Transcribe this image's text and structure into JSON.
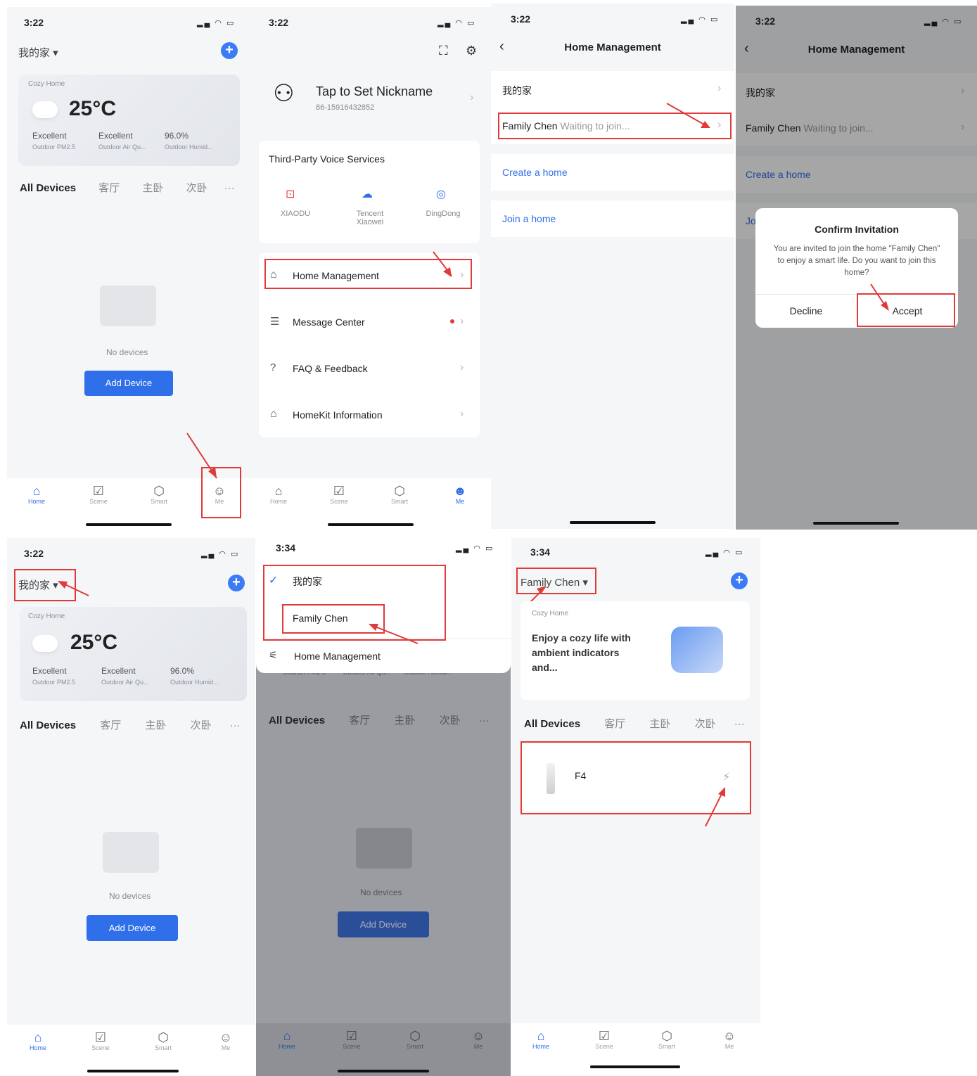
{
  "p1": {
    "time": "3:22",
    "home_selector": "我的家 ▾",
    "weather": {
      "title": "Cozy Home",
      "temp": "25°C",
      "m1_value": "Excellent",
      "m1_label": "Outdoor PM2.5",
      "m2_value": "Excellent",
      "m2_label": "Outdoor Air Qu...",
      "m3_value": "96.0%",
      "m3_label": "Outdoor Humid..."
    },
    "tabs": [
      "All Devices",
      "客厅",
      "主卧",
      "次卧",
      "···"
    ],
    "no_devices": "No devices",
    "add_device": "Add Device",
    "nav": [
      "Home",
      "Scene",
      "Smart",
      "Me"
    ]
  },
  "p2": {
    "time": "3:22",
    "nickname": "Tap to Set Nickname",
    "phone": "86-15916432852",
    "voice_title": "Third-Party Voice Services",
    "voice": [
      "XIAODU",
      "Tencent Xiaowei",
      "DingDong"
    ],
    "menu": [
      "Home Management",
      "Message Center",
      "FAQ & Feedback",
      "HomeKit Information"
    ],
    "nav": [
      "Home",
      "Scene",
      "Smart",
      "Me"
    ]
  },
  "p3": {
    "time": "3:22",
    "title": "Home Management",
    "home1": "我的家",
    "home2_name": "Family Chen",
    "home2_status": "Waiting to join...",
    "create": "Create a home",
    "join": "Join a home"
  },
  "p4": {
    "time": "3:22",
    "title": "Home Management",
    "home1": "我的家",
    "home2_name": "Family Chen",
    "home2_status": "Waiting to join...",
    "create": "Create a home",
    "join_partial": "Jo",
    "dialog_title": "Confirm Invitation",
    "dialog_body": "You are invited to join the home \"Family Chen\" to enjoy a smart life. Do you want to join this home?",
    "decline": "Decline",
    "accept": "Accept"
  },
  "p5": {
    "time": "3:22",
    "home_selector": "我的家 ▾",
    "weather": {
      "title": "Cozy Home",
      "temp": "25°C",
      "m1_value": "Excellent",
      "m1_label": "Outdoor PM2.5",
      "m2_value": "Excellent",
      "m2_label": "Outdoor Air Qu...",
      "m3_value": "96.0%",
      "m3_label": "Outdoor Humid..."
    },
    "tabs": [
      "All Devices",
      "客厅",
      "主卧",
      "次卧",
      "···"
    ],
    "no_devices": "No devices",
    "add_device": "Add Device",
    "nav": [
      "Home",
      "Scene",
      "Smart",
      "Me"
    ]
  },
  "p6": {
    "time": "3:34",
    "dropdown": [
      "我的家",
      "Family Chen",
      "Home Management"
    ],
    "under_labels": [
      "Outdoor PM2.5",
      "Outdoor Air Qu...",
      "Outdoor Humid..."
    ],
    "tabs": [
      "All Devices",
      "客厅",
      "主卧",
      "次卧",
      "···"
    ],
    "no_devices": "No devices",
    "add_device": "Add Device",
    "nav": [
      "Home",
      "Scene",
      "Smart",
      "Me"
    ]
  },
  "p7": {
    "time": "3:34",
    "home_selector": "Family Chen ▾",
    "banner_small": "Cozy Home",
    "banner_text": "Enjoy a cozy life with ambient indicators and...",
    "tabs": [
      "All Devices",
      "客厅",
      "主卧",
      "次卧",
      "···"
    ],
    "device_name": "F4",
    "nav": [
      "Home",
      "Scene",
      "Smart",
      "Me"
    ]
  }
}
